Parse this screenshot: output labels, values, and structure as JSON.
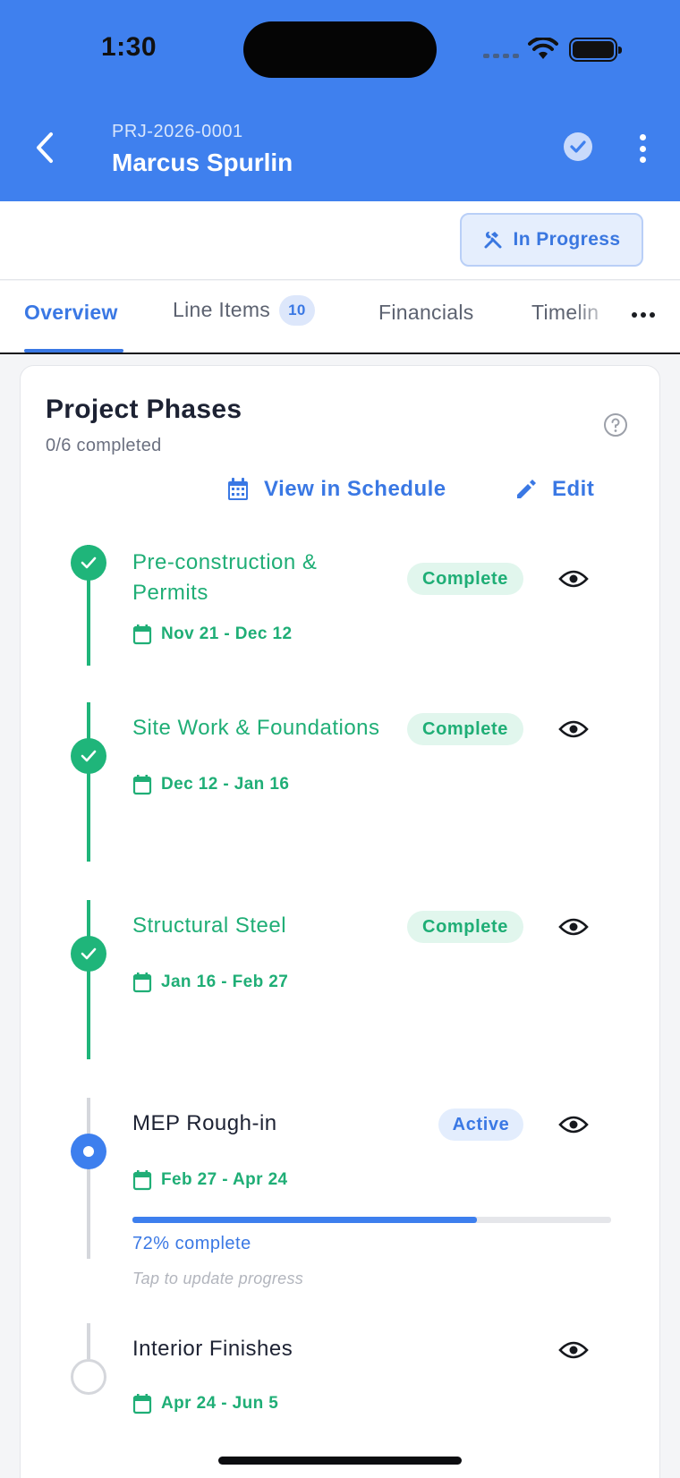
{
  "status_bar": {
    "time": "1:30"
  },
  "header": {
    "project_id": "PRJ-2026-0001",
    "project_name": "Marcus Spurlin",
    "background_color": "#3f80ee"
  },
  "status_chip": {
    "label": "In Progress",
    "icon": "hammer-wrench-icon"
  },
  "tabs": [
    {
      "label": "Overview",
      "active": true
    },
    {
      "label": "Line Items",
      "badge": "10"
    },
    {
      "label": "Financials"
    },
    {
      "label": "Timelin"
    }
  ],
  "phases_card": {
    "title": "Project Phases",
    "subtitle": "0/6 completed",
    "view_schedule_label": "View in Schedule",
    "edit_label": "Edit",
    "phases": [
      {
        "name": "Pre-construction & Permits",
        "dates": "Nov 21 - Dec 12",
        "status": "Complete"
      },
      {
        "name": "Site Work & Foundations",
        "dates": "Dec 12 - Jan 16",
        "status": "Complete"
      },
      {
        "name": "Structural Steel",
        "dates": "Jan 16 - Feb 27",
        "status": "Complete"
      },
      {
        "name": "MEP Rough-in",
        "dates": "Feb 27 - Apr 24",
        "status": "Active",
        "progress": 0.72,
        "progress_label": "72% complete",
        "hint": "Tap to update progress"
      },
      {
        "name": "Interior Finishes",
        "dates": "Apr 24 - Jun 5",
        "status": ""
      }
    ]
  },
  "colors": {
    "accent": "#3a78e4",
    "complete": "#1fae76",
    "active": "#3d7fee"
  }
}
